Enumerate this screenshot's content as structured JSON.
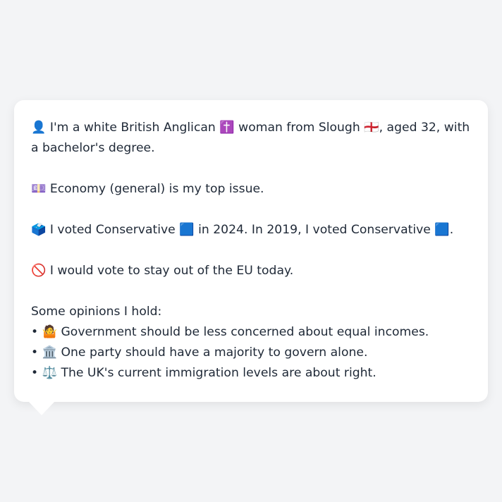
{
  "profile": {
    "identity": {
      "icon": "👤",
      "t1": "I'm a white British Anglican",
      "icon_religion": "✝️",
      "t2": "woman from Slough",
      "icon_flag": "🏴󠁧󠁢󠁥󠁮󠁧󠁿",
      "t3": ", aged 32, with a bachelor's degree."
    },
    "issue": {
      "icon": "💷",
      "text": "Economy (general) is my top issue."
    },
    "vote": {
      "icon": "🗳️",
      "t1": "I voted Conservative",
      "party_icon_1": "🟦",
      "t2": "in 2024. In 2019, I voted Conservative",
      "party_icon_2": "🟦",
      "t3": "."
    },
    "eu": {
      "icon": "🚫",
      "text": "I would vote to stay out of the EU today."
    },
    "opinions": {
      "heading": "Some opinions I hold:",
      "bullet": "•",
      "items": [
        {
          "icon": "🤷",
          "text": "Government should be less concerned about equal incomes."
        },
        {
          "icon": "🏛️",
          "text": "One party should have a majority to govern alone."
        },
        {
          "icon": "⚖️",
          "text": "The UK's current immigration levels are about right."
        }
      ]
    }
  }
}
